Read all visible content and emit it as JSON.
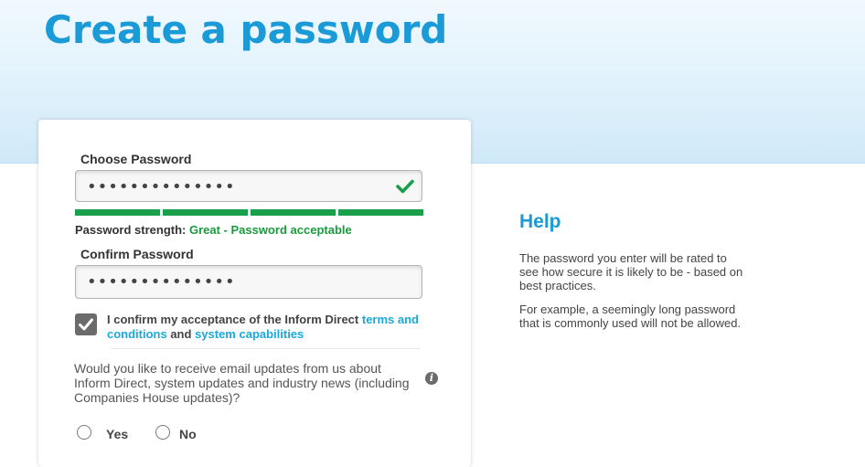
{
  "header": {
    "title": "Create a password"
  },
  "form": {
    "choose_password_label": "Choose Password",
    "choose_password_value": "••••••••••••••",
    "strength_label": "Password strength:",
    "strength_value": "Great - Password acceptable",
    "strength_level": 1.0,
    "confirm_password_label": "Confirm Password",
    "confirm_password_value": "••••••••••••••",
    "terms": {
      "checked": true,
      "prefix": "I confirm my acceptance of the Inform Direct ",
      "terms_link": "terms and conditions",
      "joiner": " and ",
      "capabilities_link": "system capabilities"
    },
    "email_question": "Would you like to receive email updates from us about Inform Direct, system updates and industry news (including Companies House updates)?",
    "options": [
      "Yes",
      "No"
    ]
  },
  "help": {
    "title": "Help",
    "paragraph1": "The password you enter will be rated to see how secure it is likely to be - based on best practices.",
    "paragraph2": "For example, a seemingly long password that is commonly used will not be allowed."
  },
  "colors": {
    "accent": "#1a9ad6",
    "success": "#1aa04a",
    "link": "#1aa8e0"
  }
}
